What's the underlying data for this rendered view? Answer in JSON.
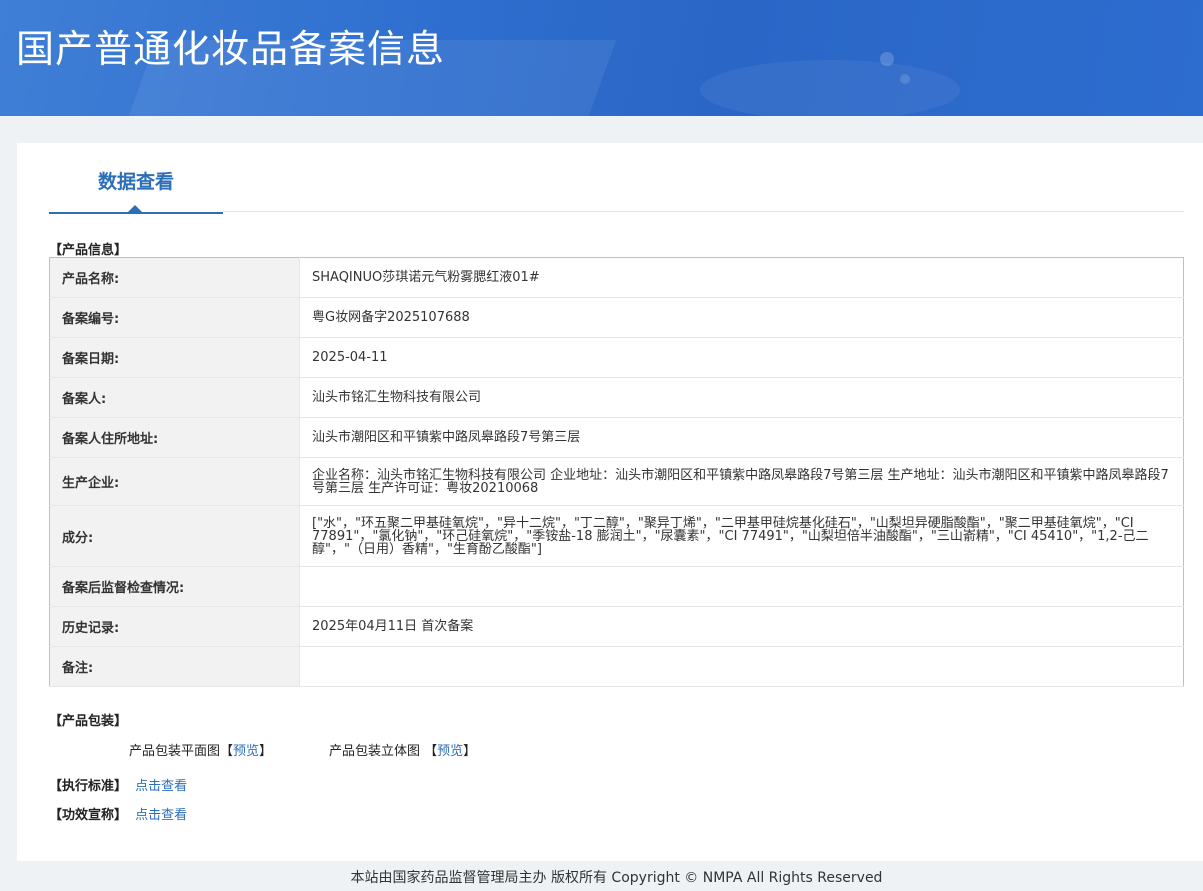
{
  "header": {
    "title": "国产普通化妆品备案信息"
  },
  "tab": {
    "label": "数据查看"
  },
  "product_info": {
    "section_label": "【产品信息】",
    "rows": [
      {
        "key": "产品名称:",
        "value": "SHAQINUO莎琪诺元气粉雾腮红液01#"
      },
      {
        "key": "备案编号:",
        "value": "粤G妆网备字2025107688"
      },
      {
        "key": "备案日期:",
        "value": "2025-04-11"
      },
      {
        "key": "备案人:",
        "value": "汕头市铭汇生物科技有限公司"
      },
      {
        "key": "备案人住所地址:",
        "value": "汕头市潮阳区和平镇紫中路凤皋路段7号第三层"
      },
      {
        "key": "生产企业:",
        "value": "企业名称：汕头市铭汇生物科技有限公司 企业地址：汕头市潮阳区和平镇紫中路凤皋路段7号第三层 生产地址：汕头市潮阳区和平镇紫中路凤皋路段7号第三层 生产许可证：粤妆20210068"
      },
      {
        "key": "成分:",
        "value": "[\"水\"，\"环五聚二甲基硅氧烷\"，\"异十二烷\"，\"丁二醇\"，\"聚异丁烯\"，\"二甲基甲硅烷基化硅石\"，\"山梨坦异硬脂酸酯\"，\"聚二甲基硅氧烷\"，\"CI 77891\"，\"氯化钠\"，\"环己硅氧烷\"，\"季铵盐-18 膨润土\"，\"尿囊素\"，\"CI 77491\"，\"山梨坦倍半油酸酯\"，\"三山嵛精\"，\"CI 45410\"，\"1,2-己二醇\"，\"（日用）香精\"，\"生育酚乙酸酯\"]"
      },
      {
        "key": "备案后监督检查情况:",
        "value": ""
      },
      {
        "key": "历史记录:",
        "value": "2025年04月11日 首次备案"
      },
      {
        "key": "备注:",
        "value": ""
      }
    ]
  },
  "packaging": {
    "section_label": "【产品包装】",
    "flat_label": "产品包装平面图【",
    "flat_link": "预览",
    "flat_close": "】",
    "solid_label": "产品包装立体图 【",
    "solid_link": "预览",
    "solid_close": "】"
  },
  "standard": {
    "label": "【执行标准】",
    "link": "点击查看"
  },
  "efficacy": {
    "label": "【功效宣称】",
    "link": "点击查看"
  },
  "footer": {
    "text": "本站由国家药品监督管理局主办 版权所有 Copyright © NMPA All Rights Reserved"
  }
}
